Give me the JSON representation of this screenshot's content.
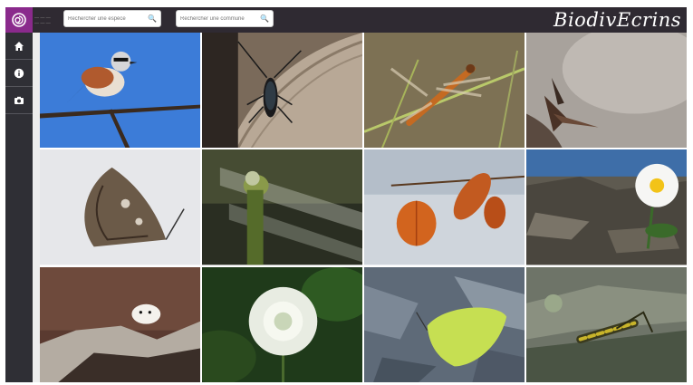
{
  "header": {
    "search_species_placeholder": "Rechercher une espèce",
    "search_commune_placeholder": "Rechercher une commune",
    "brand_title": "BiodivEcrins"
  },
  "sidebar": {
    "items": [
      {
        "name": "home",
        "icon": "home-icon"
      },
      {
        "name": "info",
        "icon": "info-icon"
      },
      {
        "name": "gallery",
        "icon": "camera-icon"
      }
    ]
  },
  "gallery": {
    "photos": [
      "Pie-grièche écorcheur",
      "Longicorne",
      "Libellule",
      "Papillon",
      "Belle-Dame",
      "Libellule",
      "Physalis",
      "Marguerite",
      "Hermine",
      "Astrance",
      "Citron",
      "Criquet"
    ]
  },
  "colors": {
    "brand_purple": "#8a2a8c",
    "topbar": "#2f2a32",
    "sidebar": "#2f2f35"
  }
}
